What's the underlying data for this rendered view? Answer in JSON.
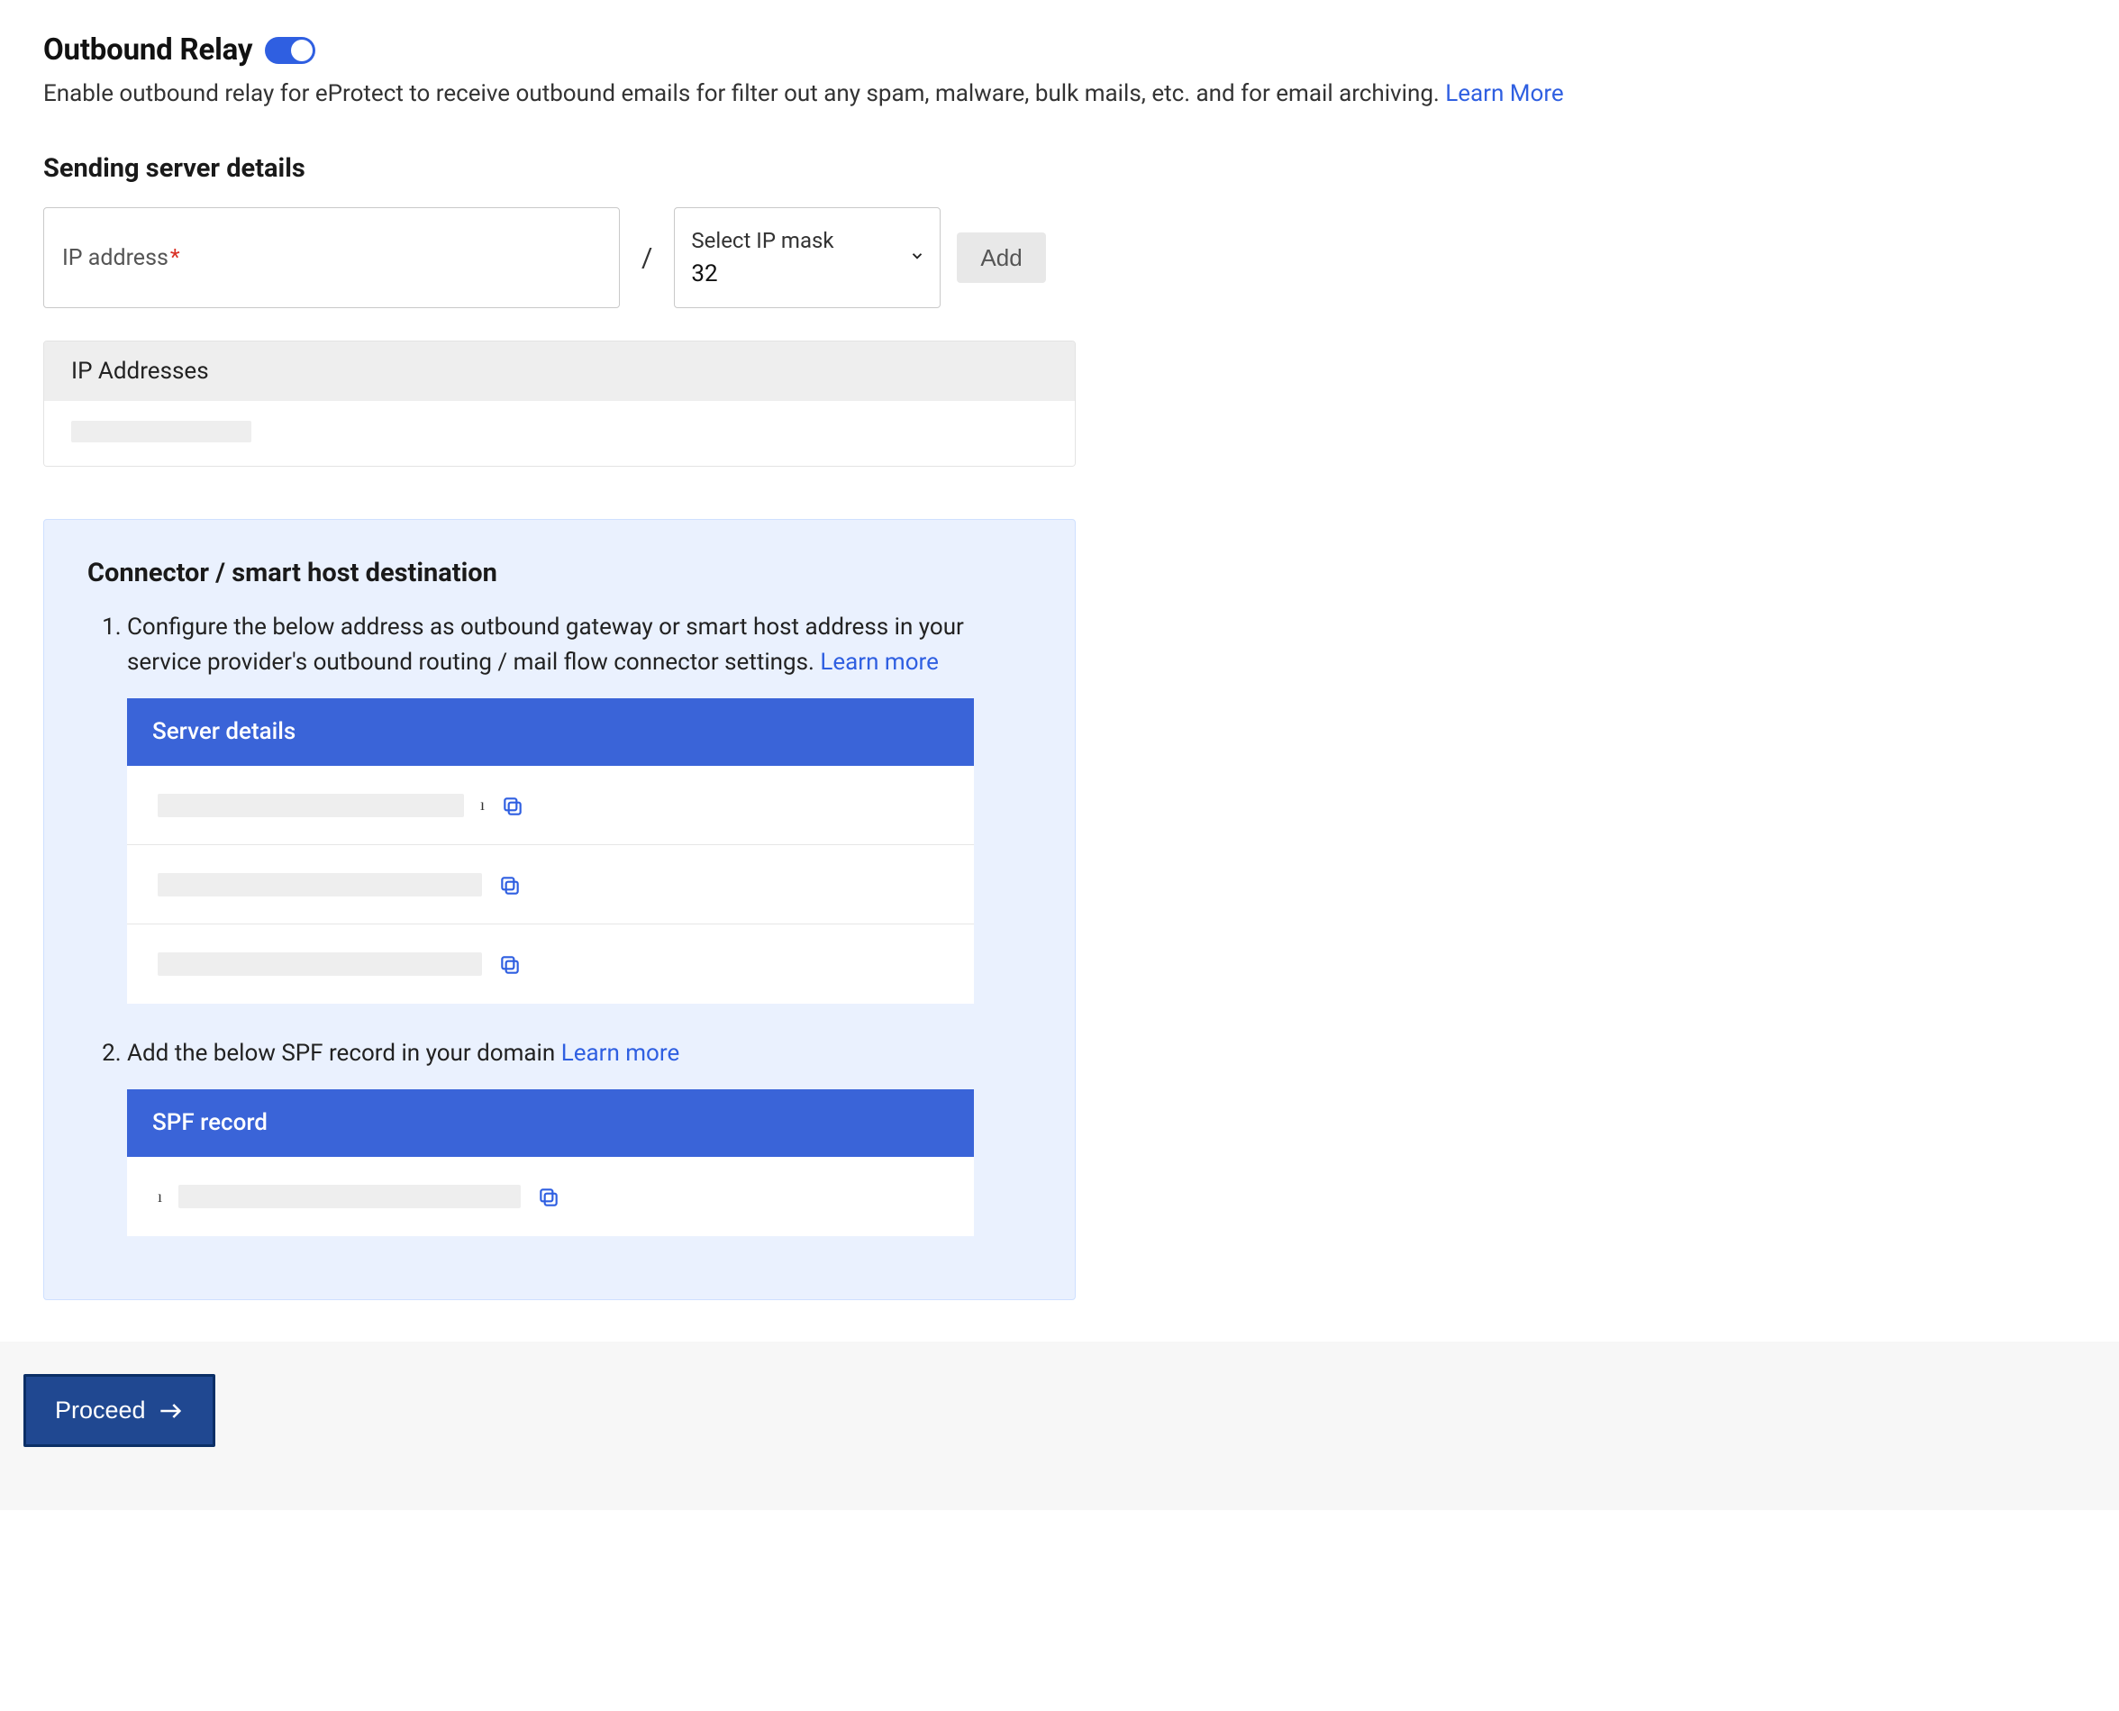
{
  "outboundRelay": {
    "title": "Outbound Relay",
    "toggle_on": true,
    "description": "Enable outbound relay for eProtect to receive outbound emails for filter out any spam, malware, bulk mails, etc. and for email archiving.",
    "learn_more_label": "Learn More"
  },
  "sendingServer": {
    "title": "Sending server details",
    "ip_label": "IP address",
    "ip_required_mark": "*",
    "slash": "/",
    "mask_label": "Select IP mask",
    "mask_value": "32",
    "add_button": "Add",
    "table_header": "IP Addresses"
  },
  "connector": {
    "title": "Connector / smart host destination",
    "step1_text": "Configure the below address as outbound gateway or smart host address in your service provider's outbound routing / mail flow connector settings.",
    "step1_learn_more": "Learn more",
    "server_details_header": "Server details",
    "step2_text": "Add the below SPF record in your domain",
    "step2_learn_more": "Learn more",
    "spf_header": "SPF record"
  },
  "footer": {
    "proceed_label": "Proceed"
  }
}
